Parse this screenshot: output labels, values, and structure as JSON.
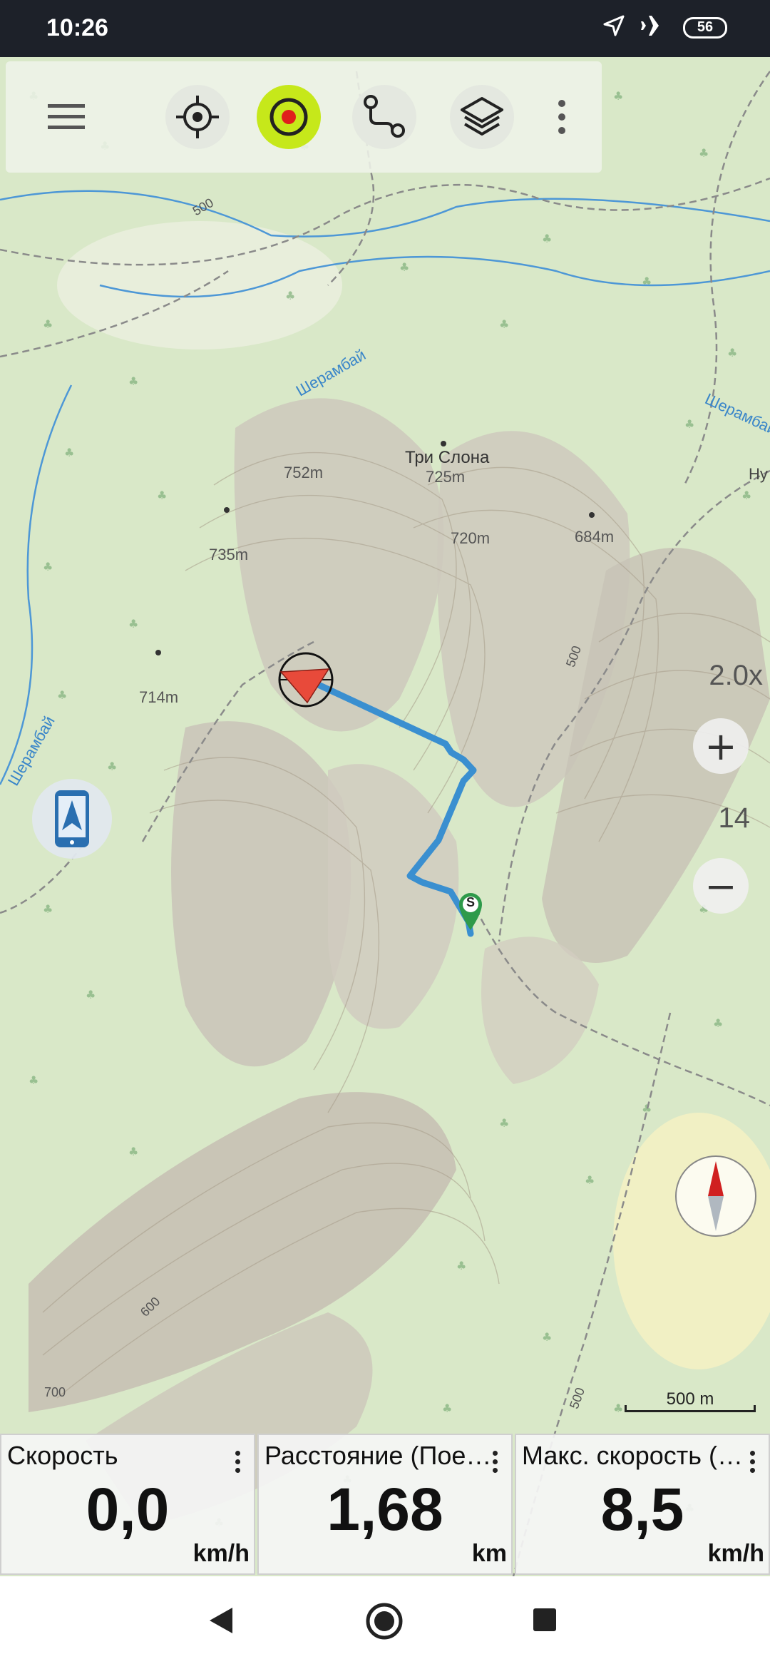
{
  "status_bar": {
    "time": "10:26",
    "battery": "56",
    "icons": [
      "location-arrow-icon",
      "airplane-mode-icon",
      "battery-icon"
    ]
  },
  "toolbar": {
    "buttons": [
      "menu-icon",
      "locate-icon",
      "track-recording-icon",
      "route-icon",
      "layers-icon",
      "more-options-icon"
    ],
    "colors": {
      "recording_active": "#c6e81a",
      "recording_dot": "#e0201c"
    }
  },
  "map": {
    "place_name": "Три Слона",
    "peaks": {
      "tri_slona": "725m",
      "p752": "752m",
      "p720": "720m",
      "p684": "684m",
      "p735": "735m",
      "p714": "714m"
    },
    "contours": {
      "c500a": "500",
      "c500b": "500",
      "c500c": "500",
      "c600": "600",
      "c700": "700"
    },
    "rivers": {
      "r1": "Шерамбай",
      "r2": "Шерамбай",
      "r3": "Шерамбай",
      "r4": "Ну"
    },
    "start_marker": "S",
    "track_color": "#3a8fd0"
  },
  "controls": {
    "zoom_factor": "2.0x",
    "zoom_in": "+",
    "zoom_level": "14",
    "zoom_out": "−",
    "scale": "500 m"
  },
  "widgets": [
    {
      "title": "Скорость",
      "value": "0,0",
      "unit": "km/h"
    },
    {
      "title": "Расстояние (Пое…",
      "value": "1,68",
      "unit": "km"
    },
    {
      "title": "Макс. скорость (…",
      "value": "8,5",
      "unit": "km/h"
    }
  ]
}
